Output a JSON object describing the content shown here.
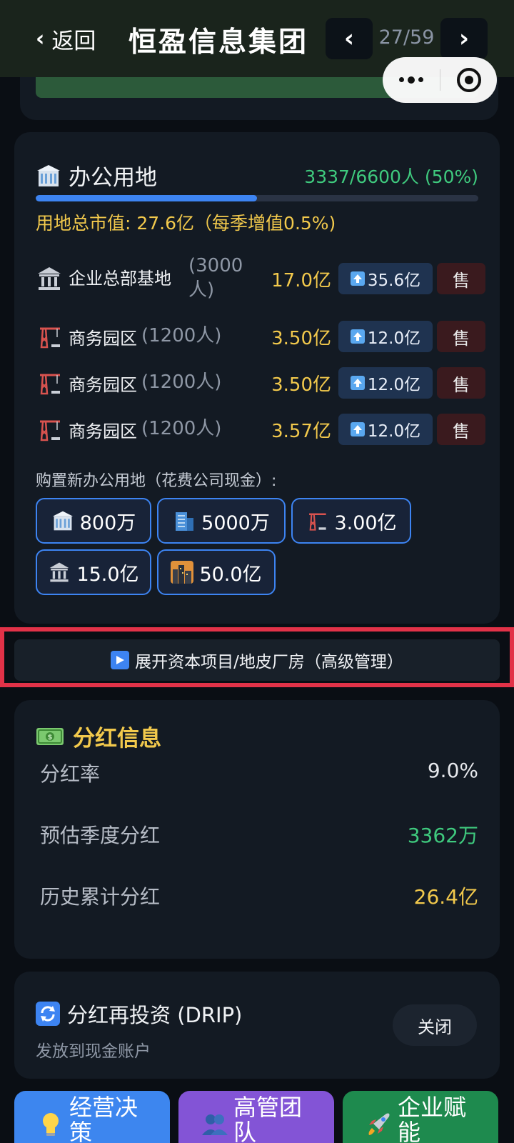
{
  "header": {
    "back_label": "返回",
    "title": "恒盈信息集团",
    "pager": "27/59"
  },
  "land": {
    "title": "办公用地",
    "capacity": "3337/6600人 (50%)",
    "progress_fraction": 0.5,
    "market_value": "用地总市值: 27.6亿（每季增值0.5%)",
    "rows": [
      {
        "name": "企业总部基地",
        "cap": "(3000人)",
        "value": "17.0亿",
        "upgrade": "35.6亿",
        "sell": "售",
        "icon": "bank-icon"
      },
      {
        "name": "商务园区",
        "cap": "(1200人)",
        "value": "3.50亿",
        "upgrade": "12.0亿",
        "sell": "售",
        "icon": "crane-icon"
      },
      {
        "name": "商务园区",
        "cap": "(1200人)",
        "value": "3.50亿",
        "upgrade": "12.0亿",
        "sell": "售",
        "icon": "crane-icon"
      },
      {
        "name": "商务园区",
        "cap": "(1200人)",
        "value": "3.57亿",
        "upgrade": "12.0亿",
        "sell": "售",
        "icon": "crane-icon"
      }
    ],
    "buy_label": "购置新办公用地（花费公司现金）:",
    "buy_options": [
      {
        "icon": "office-building-icon",
        "price": "800万"
      },
      {
        "icon": "tall-building-icon",
        "price": "5000万"
      },
      {
        "icon": "crane-icon",
        "price": "3.00亿"
      },
      {
        "icon": "bank-icon",
        "price": "15.0亿"
      },
      {
        "icon": "city-icon",
        "price": "50.0亿"
      }
    ]
  },
  "expand": {
    "label": "展开资本项目/地皮厂房（高级管理）",
    "icon": "play-icon"
  },
  "dividend": {
    "title": "分红信息",
    "rows": [
      {
        "key": "分红率",
        "value": "9.0%",
        "color": "#e6e8ec"
      },
      {
        "key": "预估季度分红",
        "value": "3362万",
        "color": "#3fca7e"
      },
      {
        "key": "历史累计分红",
        "value": "26.4亿",
        "color": "#f2c94c"
      }
    ]
  },
  "drip": {
    "title": "分红再投资 (DRIP)",
    "subtitle": "发放到现金账户",
    "toggle_label": "关闭"
  },
  "bottom_nav": [
    {
      "label": "经营决策",
      "icon": "lightbulb-icon",
      "color": "#3d86ef"
    },
    {
      "label": "高管团队",
      "icon": "people-icon",
      "color": "#8354d6"
    },
    {
      "label": "企业赋能",
      "icon": "rocket-icon",
      "color": "#1e8a4e"
    }
  ],
  "colors": {
    "accent_blue": "#3d84f2",
    "gold": "#f2c94c",
    "green": "#3fca7e",
    "highlight_red": "#e23248"
  }
}
